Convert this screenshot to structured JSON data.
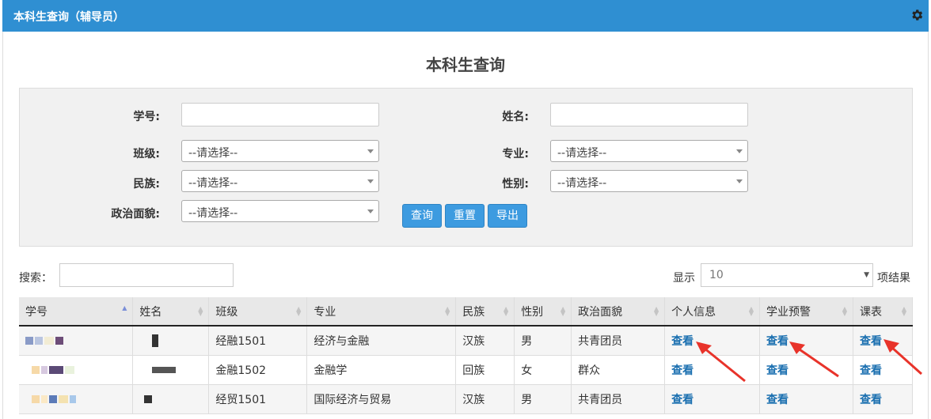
{
  "header": {
    "title": "本科生查询（辅导员）",
    "gear_icon": "gear-icon"
  },
  "page": {
    "title": "本科生查询"
  },
  "filters": {
    "student_id_label": "学号:",
    "name_label": "姓名:",
    "class_label": "班级:",
    "class_value": "--请选择--",
    "major_label": "专业:",
    "major_value": "--请选择--",
    "ethnicity_label": "民族:",
    "ethnicity_value": "--请选择--",
    "gender_label": "性别:",
    "gender_value": "--请选择--",
    "politics_label": "政治面貌:",
    "politics_value": "--请选择--",
    "query_button": "查询",
    "reset_button": "重置",
    "export_button": "导出"
  },
  "table_controls": {
    "search_label": "搜索：",
    "show_label": "显示",
    "page_size": "10",
    "show_suffix": "项结果"
  },
  "table": {
    "columns": [
      "学号",
      "姓名",
      "班级",
      "专业",
      "民族",
      "性别",
      "政治面貌",
      "个人信息",
      "学业预警",
      "课表"
    ],
    "rows": [
      {
        "class": "经融1501",
        "major": "经济与金融",
        "ethnicity": "汉族",
        "gender": "男",
        "politics": "共青团员",
        "info": "查看",
        "warning": "查看",
        "schedule": "查看"
      },
      {
        "class": "金融1502",
        "major": "金融学",
        "ethnicity": "回族",
        "gender": "女",
        "politics": "群众",
        "info": "查看",
        "warning": "查看",
        "schedule": "查看"
      },
      {
        "class": "经贸1501",
        "major": "国际经济与贸易",
        "ethnicity": "汉族",
        "gender": "男",
        "politics": "共青团员",
        "info": "查看",
        "warning": "查看",
        "schedule": "查看"
      }
    ]
  },
  "colors": {
    "header_bg": "#2f8fd2",
    "button_bg": "#3d9be0",
    "link": "#1a6fb0",
    "annotation_arrow": "#e8332a"
  }
}
